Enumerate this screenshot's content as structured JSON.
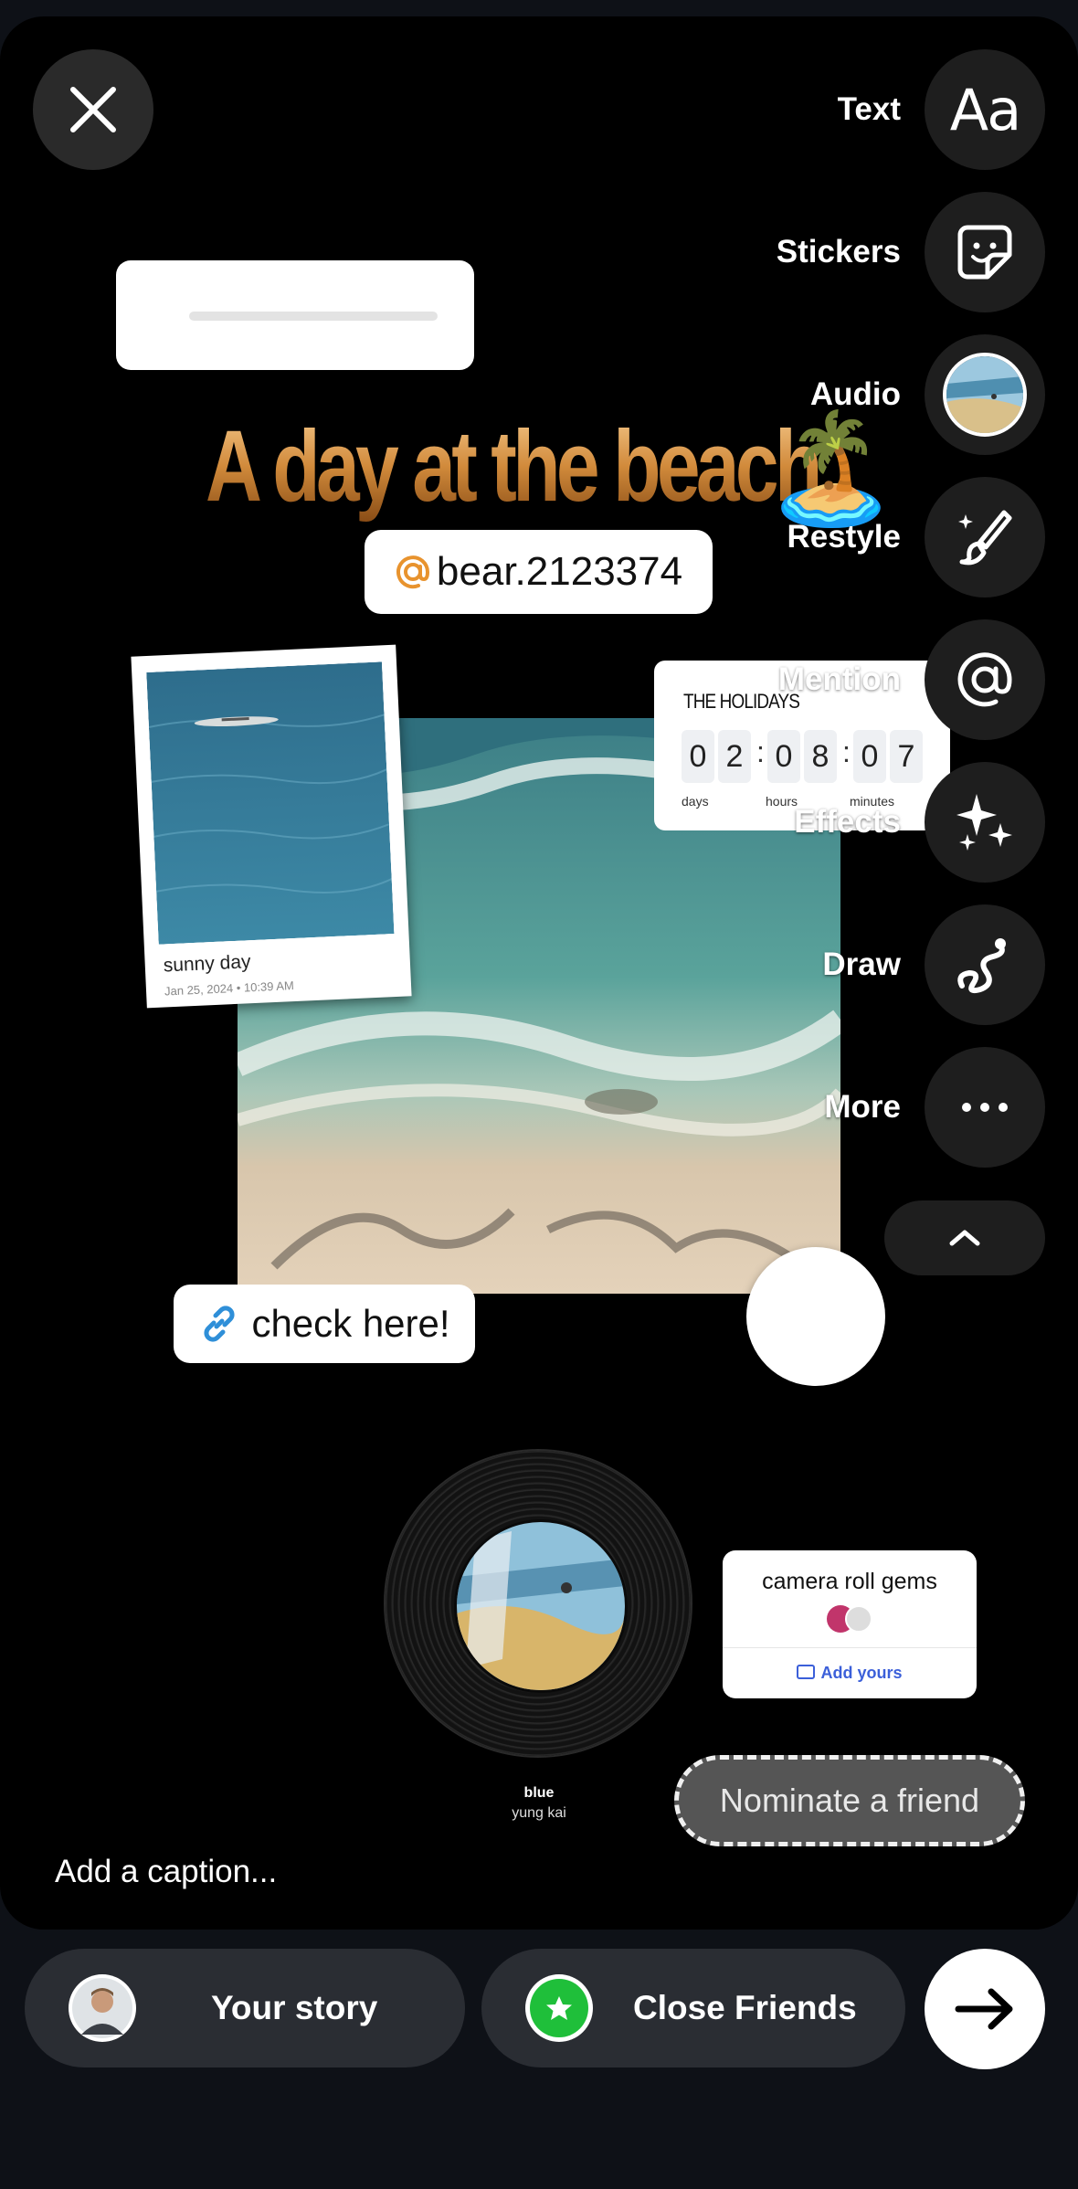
{
  "tools": [
    {
      "label": "Text",
      "icon": "text-aa-icon",
      "glyph": "Aa"
    },
    {
      "label": "Stickers",
      "icon": "sticker-icon"
    },
    {
      "label": "Audio",
      "icon": "audio-thumbnail"
    },
    {
      "label": "Restyle",
      "icon": "paintbrush-icon"
    },
    {
      "label": "Mention",
      "icon": "at-sign-icon"
    },
    {
      "label": "Effects",
      "icon": "sparkles-icon"
    },
    {
      "label": "Draw",
      "icon": "squiggle-icon"
    },
    {
      "label": "More",
      "icon": "ellipsis-icon"
    }
  ],
  "canvas": {
    "headline": "A day at the beach",
    "headline_emoji": "🏝️",
    "slider_emoji": "😍",
    "slider_value": 0.0,
    "mention_handle": "bear.2123374",
    "polaroid": {
      "caption": "sunny day",
      "date": "Jan 25, 2024 • 10:39 AM"
    },
    "countdown": {
      "title": "THE HOLIDAYS",
      "digits": [
        "0",
        "2",
        "0",
        "8",
        "0",
        "7"
      ],
      "units": [
        "days",
        "hours",
        "minutes"
      ]
    },
    "link_text": "check here!",
    "reaction_emoji": "😍",
    "music": {
      "title": "blue",
      "artist": "yung kai"
    },
    "add_yours": {
      "prompt": "camera roll gems",
      "cta": "Add yours"
    },
    "nominate": "Nominate a friend"
  },
  "caption_placeholder": "Add a caption...",
  "share": {
    "your_story": "Your story",
    "close_friends": "Close Friends"
  },
  "colors": {
    "close_friends_green": "#1fbf3a",
    "link_blue": "#2f8fd8",
    "at_orange": "#e8932e"
  }
}
